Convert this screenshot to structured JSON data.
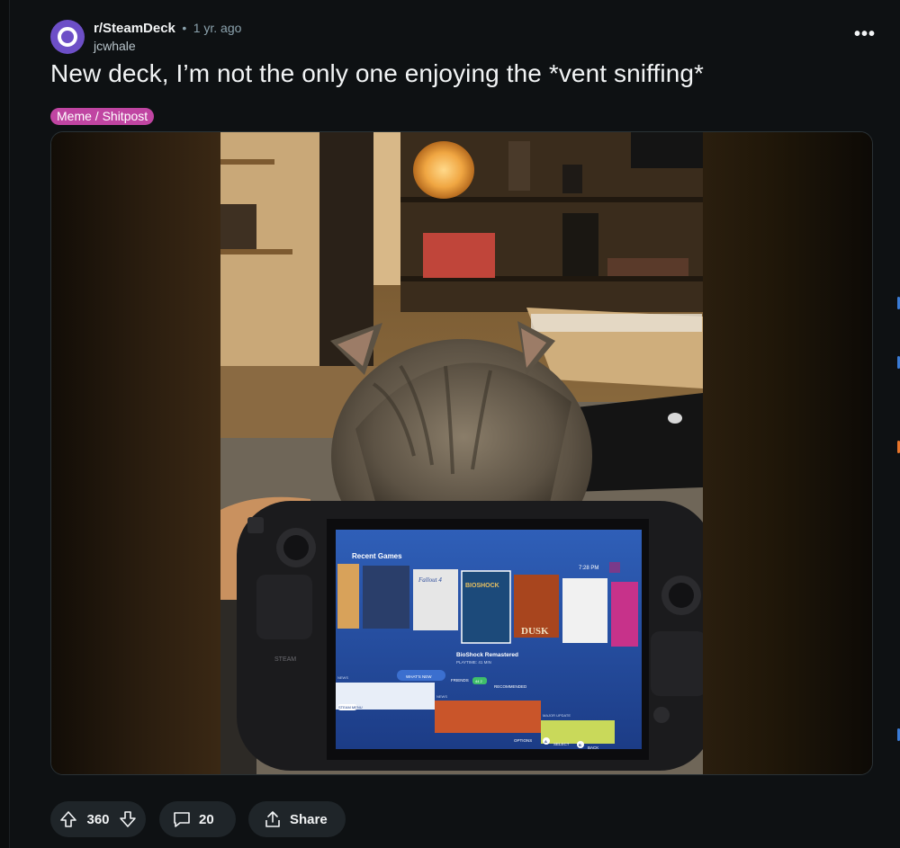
{
  "post": {
    "subreddit": "r/SteamDeck",
    "separator": "•",
    "age": "1 yr. ago",
    "author": "jcwhale",
    "title": "New deck, I’m not the only one enjoying the *vent sniffing*",
    "flair": "Meme / Shitpost",
    "flair_color": "#c045a2"
  },
  "media": {
    "screen": {
      "section": "Recent Games",
      "clock": "7:28 PM",
      "game_titles": [
        "Fallout 4",
        "BIOSHOCK",
        "DUSK"
      ],
      "selected_game": "BioShock Remastered",
      "playtime": "PLAYTIME: 41 MIN",
      "tabs": [
        "WHAT'S NEW",
        "FRIENDS",
        "RECOMMENDED"
      ],
      "friends_badge": "44 2",
      "news_labels": [
        "NEWS",
        "NEWS",
        "MAJOR UPDATE"
      ],
      "menu_label": "STEAM MENU",
      "bottom_hints": [
        "OPTIONS",
        "SELECT",
        "BACK"
      ],
      "hint_buttons": [
        "A",
        "B"
      ],
      "device_label": "STEAM"
    }
  },
  "actions": {
    "upvotes": "360",
    "comments": "20",
    "share": "Share"
  },
  "colors": {
    "background": "#0e1113",
    "pill": "#1f2529",
    "avatar": "#6d4fc7"
  },
  "icons": [
    "subreddit-avatar-icon",
    "more-options-icon",
    "upvote-icon",
    "downvote-icon",
    "comment-icon",
    "share-icon"
  ]
}
